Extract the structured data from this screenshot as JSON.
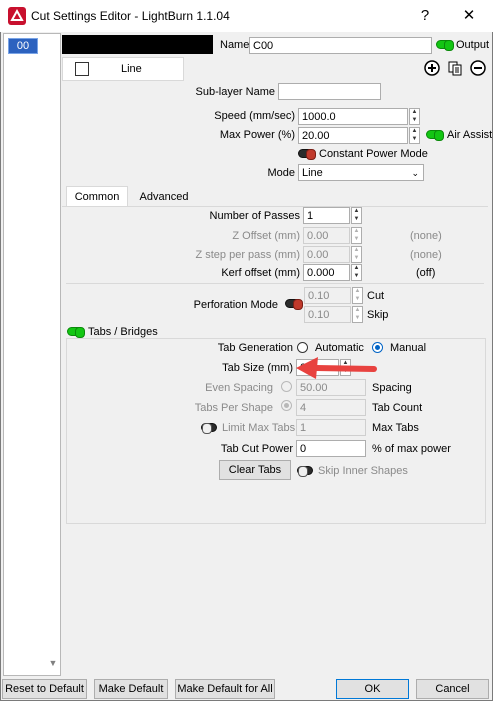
{
  "window": {
    "title": "Cut Settings Editor - LightBurn 1.1.04",
    "help_glyph": "?",
    "close_glyph": "✕"
  },
  "layer_list": {
    "selected_layer": "00"
  },
  "header": {
    "name_label": "Name",
    "name_value": "C00",
    "output_label": "Output",
    "line_tab_label": "Line",
    "sublayer_label": "Sub-layer Name",
    "sublayer_value": ""
  },
  "settings": {
    "speed_label": "Speed (mm/sec)",
    "speed_value": "1000.0",
    "max_power_label": "Max Power (%)",
    "max_power_value": "20.00",
    "air_assist_label": "Air Assist",
    "constant_power_label": "Constant Power Mode",
    "mode_label": "Mode",
    "mode_value": "Line"
  },
  "tabs": {
    "common": "Common",
    "advanced": "Advanced"
  },
  "common": {
    "passes_label": "Number of Passes",
    "passes_value": "1",
    "z_offset_label": "Z Offset (mm)",
    "z_offset_value": "0.00",
    "z_offset_note": "(none)",
    "z_step_label": "Z step per pass (mm)",
    "z_step_value": "0.00",
    "z_step_note": "(none)",
    "kerf_label": "Kerf offset (mm)",
    "kerf_value": "0.000",
    "kerf_note": "(off)",
    "perforation_label": "Perforation Mode",
    "perf_cut_value": "0.10",
    "perf_cut_label": "Cut",
    "perf_skip_value": "0.10",
    "perf_skip_label": "Skip"
  },
  "tabs_bridges": {
    "label": "Tabs / Bridges",
    "generation_label": "Tab Generation",
    "automatic_label": "Automatic",
    "manual_label": "Manual",
    "tab_size_label": "Tab Size (mm)",
    "tab_size_value": "0",
    "even_spacing_label": "Even Spacing",
    "spacing_value": "50.00",
    "spacing_label": "Spacing",
    "tabs_per_shape_label": "Tabs Per Shape",
    "tab_count_value": "4",
    "tab_count_label": "Tab Count",
    "limit_max_label": "Limit Max Tabs",
    "max_tabs_value": "1",
    "max_tabs_label": "Max Tabs",
    "cut_power_label": "Tab Cut Power",
    "cut_power_value": "0",
    "cut_power_unit": "% of max power",
    "clear_tabs_label": "Clear Tabs",
    "skip_inner_label": "Skip Inner Shapes"
  },
  "footer": {
    "reset_label": "Reset to Default",
    "make_default_label": "Make Default",
    "make_default_all_label": "Make Default for All",
    "ok_label": "OK",
    "cancel_label": "Cancel"
  },
  "colors": {
    "toggle_on": "#13c613",
    "toggle_off_knob": "#c0392b",
    "arrow": "#e8423f",
    "accent": "#0078d7"
  }
}
